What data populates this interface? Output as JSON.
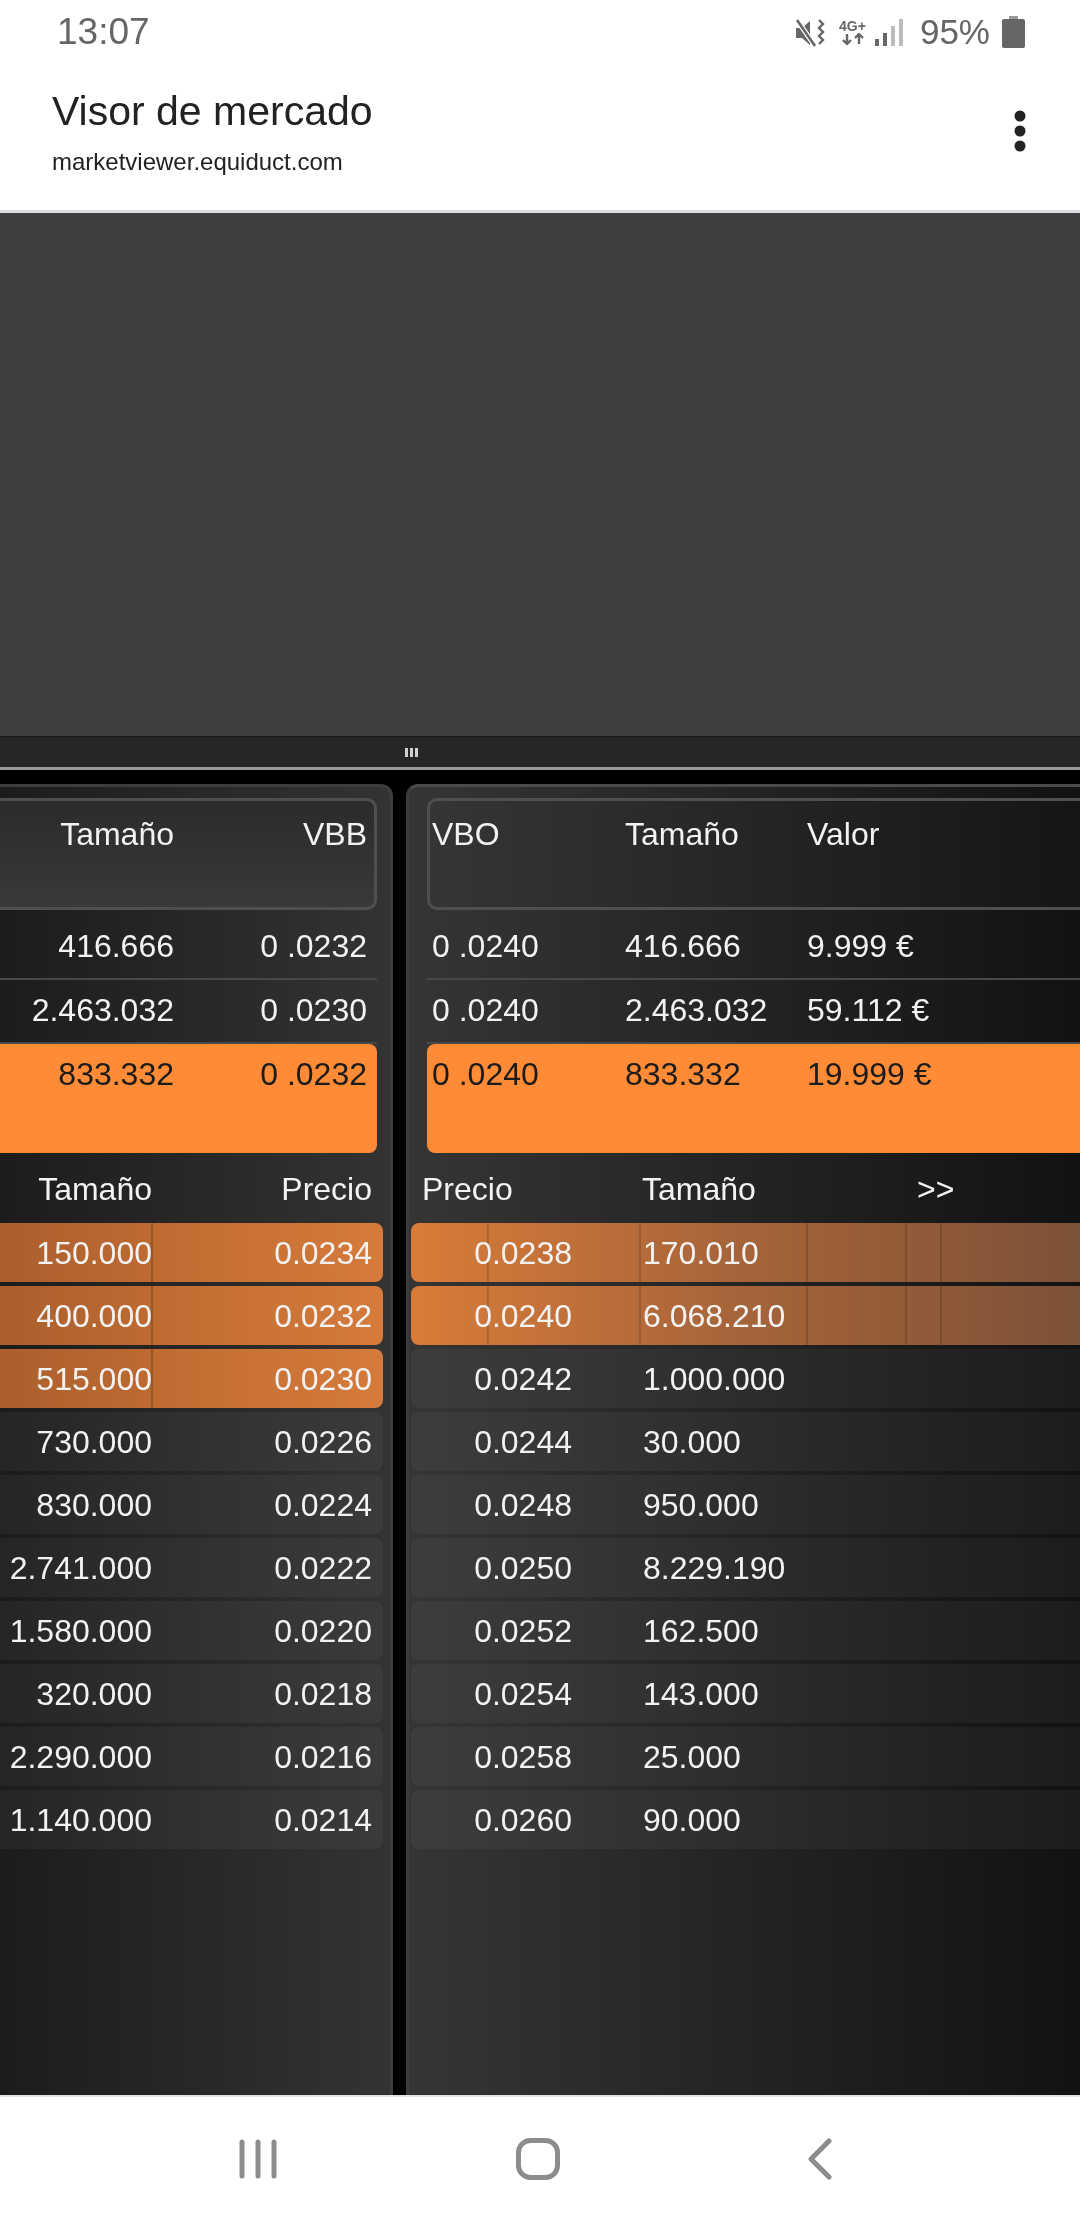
{
  "status_bar": {
    "time": "13:07",
    "network_type": "4G+",
    "battery": "95%"
  },
  "app_bar": {
    "title": "Visor de mercado",
    "url": "marketviewer.equiduct.com"
  },
  "left_panel": {
    "summary": {
      "columns": [
        "Tamaño",
        "VBB"
      ],
      "rows": [
        {
          "cells": [
            "416.666",
            "0 .0232"
          ],
          "selected": false
        },
        {
          "cells": [
            "2.463.032",
            "0 .0230"
          ],
          "selected": false
        },
        {
          "cells": [
            "833.332",
            "0 .0232"
          ],
          "selected": true
        }
      ]
    },
    "book": {
      "columns": [
        "Tamaño",
        "Precio"
      ],
      "rows": [
        {
          "cells": [
            "150.000",
            "0.0234"
          ],
          "highlighted": true
        },
        {
          "cells": [
            "400.000",
            "0.0232"
          ],
          "highlighted": true
        },
        {
          "cells": [
            "515.000",
            "0.0230"
          ],
          "highlighted": true
        },
        {
          "cells": [
            "730.000",
            "0.0226"
          ],
          "highlighted": false
        },
        {
          "cells": [
            "830.000",
            "0.0224"
          ],
          "highlighted": false
        },
        {
          "cells": [
            "2.741.000",
            "0.0222"
          ],
          "highlighted": false
        },
        {
          "cells": [
            "1.580.000",
            "0.0220"
          ],
          "highlighted": false
        },
        {
          "cells": [
            "320.000",
            "0.0218"
          ],
          "highlighted": false
        },
        {
          "cells": [
            "2.290.000",
            "0.0216"
          ],
          "highlighted": false
        },
        {
          "cells": [
            "1.140.000",
            "0.0214"
          ],
          "highlighted": false
        }
      ]
    }
  },
  "right_panel": {
    "summary": {
      "columns": [
        "VBO",
        "Tamaño",
        "Valor"
      ],
      "rows": [
        {
          "cells": [
            "0 .0240",
            "416.666",
            "9.999 €"
          ],
          "selected": false
        },
        {
          "cells": [
            "0 .0240",
            "2.463.032",
            "59.112 €"
          ],
          "selected": false
        },
        {
          "cells": [
            "0 .0240",
            "833.332",
            "19.999 €"
          ],
          "selected": true
        }
      ]
    },
    "book": {
      "columns": [
        "Precio",
        "Tamaño"
      ],
      "more_button": ">>",
      "rows": [
        {
          "cells": [
            "0.0238",
            "170.010"
          ],
          "highlighted": true
        },
        {
          "cells": [
            "0.0240",
            "6.068.210"
          ],
          "highlighted": true
        },
        {
          "cells": [
            "0.0242",
            "1.000.000"
          ],
          "highlighted": false
        },
        {
          "cells": [
            "0.0244",
            "30.000"
          ],
          "highlighted": false
        },
        {
          "cells": [
            "0.0248",
            "950.000"
          ],
          "highlighted": false
        },
        {
          "cells": [
            "0.0250",
            "8.229.190"
          ],
          "highlighted": false
        },
        {
          "cells": [
            "0.0252",
            "162.500"
          ],
          "highlighted": false
        },
        {
          "cells": [
            "0.0254",
            "143.000"
          ],
          "highlighted": false
        },
        {
          "cells": [
            "0.0258",
            "25.000"
          ],
          "highlighted": false
        },
        {
          "cells": [
            "0.0260",
            "90.000"
          ],
          "highlighted": false
        }
      ]
    }
  }
}
